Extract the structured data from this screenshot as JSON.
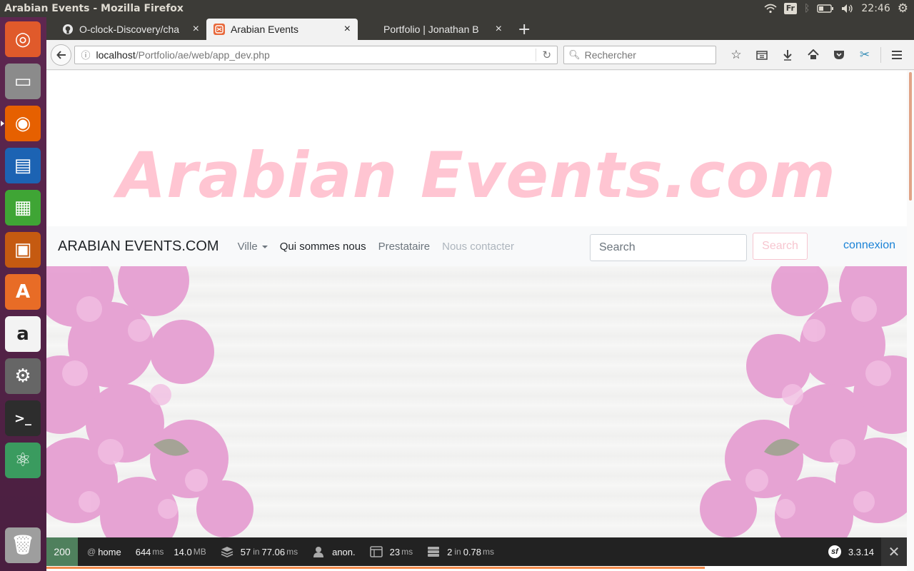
{
  "os": {
    "window_title": "Arabian Events - Mozilla Firefox",
    "keyboard_layout": "Fr",
    "clock": "22:46"
  },
  "launcher": {
    "items": [
      {
        "name": "ubuntu-dash",
        "color": "#e05a2b",
        "glyph": "◎"
      },
      {
        "name": "files",
        "color": "#8b8b8b",
        "glyph": "▭"
      },
      {
        "name": "firefox",
        "color": "#e66000",
        "glyph": "◉"
      },
      {
        "name": "libreoffice-writer",
        "color": "#1c63b3",
        "glyph": "▤"
      },
      {
        "name": "libreoffice-calc",
        "color": "#3fa535",
        "glyph": "▦"
      },
      {
        "name": "libreoffice-impress",
        "color": "#c55a11",
        "glyph": "▣"
      },
      {
        "name": "software-center",
        "color": "#e86c26",
        "glyph": "A"
      },
      {
        "name": "amazon",
        "color": "#f3f3f3",
        "glyph": "a"
      },
      {
        "name": "system-settings",
        "color": "#666666",
        "glyph": "⚙"
      },
      {
        "name": "terminal",
        "color": "#2d2d2d",
        "glyph": ">_"
      },
      {
        "name": "atom",
        "color": "#3a9b5f",
        "glyph": "⚛"
      },
      {
        "name": "trash",
        "color": "#9e9e9e",
        "glyph": "🗑"
      }
    ]
  },
  "browser": {
    "tabs": [
      {
        "label": "O-clock-Discovery/cha",
        "icon": "github-icon",
        "active": false
      },
      {
        "label": "Arabian Events",
        "icon": "symfony-icon",
        "active": true
      },
      {
        "label": "Portfolio | Jonathan B",
        "icon": "",
        "active": false
      }
    ],
    "url": {
      "host": "localhost",
      "path": "/Portfolio/ae/web/app_dev.php"
    },
    "search_placeholder": "Rechercher"
  },
  "page": {
    "hero_title": "Arabian Events.com",
    "nav": {
      "brand": "ARABIAN EVENTS.COM",
      "links": [
        "Ville",
        "Qui sommes nous",
        "Prestataire",
        "Nous contacter"
      ],
      "search_placeholder": "Search",
      "search_button": "Search",
      "login": "connexion"
    }
  },
  "symfony_toolbar": {
    "status_code": "200",
    "route": "home",
    "time_value": "644",
    "time_unit": "ms",
    "memory_value": "14.0",
    "memory_unit": "MB",
    "db_queries": "57",
    "db_in": "in",
    "db_time": "77.06",
    "db_unit": "ms",
    "user": "anon.",
    "twig_time": "23",
    "twig_unit": "ms",
    "cache_count": "2",
    "cache_in": "in",
    "cache_time": "0.78",
    "cache_unit": "ms",
    "version": "3.3.14"
  }
}
